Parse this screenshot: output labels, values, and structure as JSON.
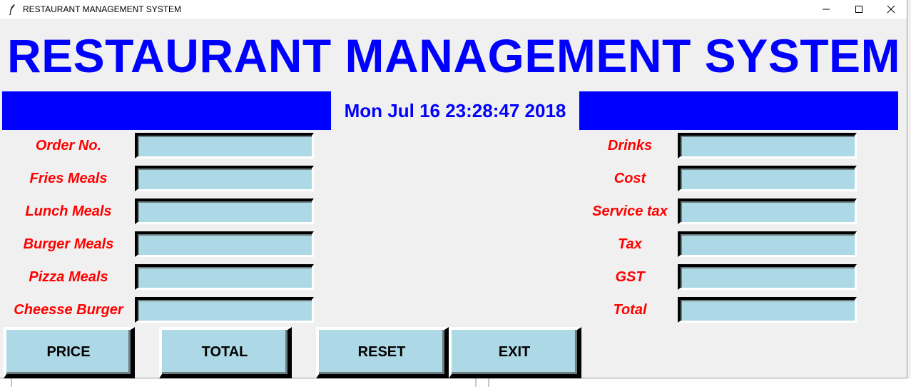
{
  "window": {
    "title": "RESTAURANT MANAGEMENT SYSTEM",
    "controls": [
      "minimize",
      "maximize",
      "close"
    ]
  },
  "header": {
    "title": "RESTAURANT MANAGEMENT SYSTEM",
    "datetime": "Mon Jul 16 23:28:47 2018"
  },
  "left_fields": [
    {
      "label": "Order No.",
      "value": ""
    },
    {
      "label": "Fries Meals",
      "value": ""
    },
    {
      "label": "Lunch Meals",
      "value": ""
    },
    {
      "label": "Burger Meals",
      "value": ""
    },
    {
      "label": "Pizza Meals",
      "value": ""
    },
    {
      "label": "Cheesse Burger",
      "value": ""
    }
  ],
  "right_fields": [
    {
      "label": "Drinks",
      "value": ""
    },
    {
      "label": "Cost",
      "value": ""
    },
    {
      "label": "Service tax",
      "value": ""
    },
    {
      "label": "Tax",
      "value": ""
    },
    {
      "label": "GST",
      "value": ""
    },
    {
      "label": "Total",
      "value": ""
    }
  ],
  "buttons": {
    "price": "PRICE",
    "total": "TOTAL",
    "reset": "RESET",
    "exit": "EXIT"
  },
  "colors": {
    "title": "#0000ff",
    "labels": "#ff0000",
    "field_bg": "#add8e6",
    "window_bg": "#f0f0f0"
  }
}
